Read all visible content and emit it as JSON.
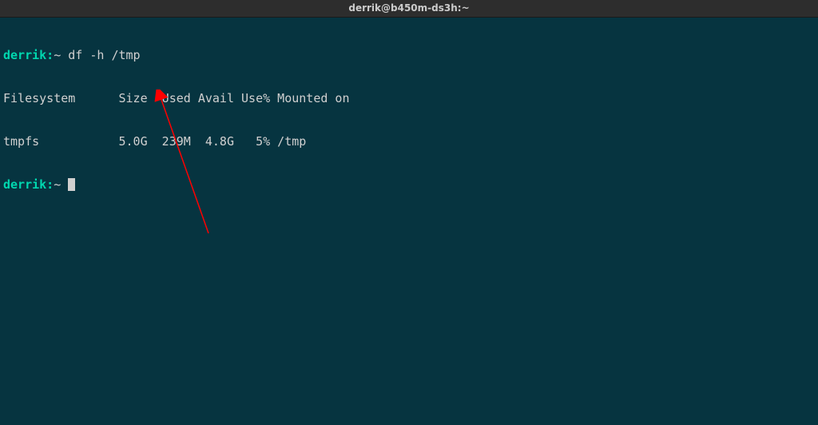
{
  "titlebar": {
    "title": "derrik@b450m-ds3h:~"
  },
  "terminal": {
    "prompt1": {
      "user": "derrik:",
      "path": "~",
      "command": "df -h /tmp"
    },
    "output": {
      "header": "Filesystem      Size  Used Avail Use% Mounted on",
      "row1": "tmpfs           5.0G  239M  4.8G   5% /tmp"
    },
    "prompt2": {
      "user": "derrik:",
      "path": "~"
    }
  },
  "chart_data": {
    "type": "table",
    "title": "df -h /tmp",
    "columns": [
      "Filesystem",
      "Size",
      "Used",
      "Avail",
      "Use%",
      "Mounted on"
    ],
    "rows": [
      [
        "tmpfs",
        "5.0G",
        "239M",
        "4.8G",
        "5%",
        "/tmp"
      ]
    ]
  }
}
